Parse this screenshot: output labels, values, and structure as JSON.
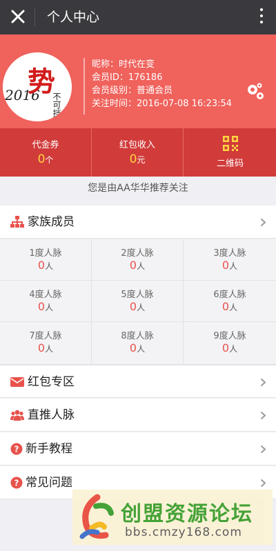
{
  "header": {
    "title": "个人中心"
  },
  "profile": {
    "avatar_text_year": "2016",
    "avatar_text_main": "势",
    "avatar_text_side": "不可挡",
    "nickname": "昵称：时代在变",
    "member_id": "会员ID：176186",
    "member_level": "会员级别：普通会员",
    "follow_time": "关注时间：2016-07-08 16:23:54"
  },
  "stats": [
    {
      "label": "代金券",
      "value": "0",
      "unit": "个"
    },
    {
      "label": "红包收入",
      "value": "0",
      "unit": "元"
    },
    {
      "label": "二维码"
    }
  ],
  "recommend_text": "您是由AA华华推荐关注",
  "family": {
    "label": "家族成员"
  },
  "network": [
    {
      "label": "1度人脉",
      "value": "0",
      "unit": "人"
    },
    {
      "label": "2度人脉",
      "value": "0",
      "unit": "人"
    },
    {
      "label": "3度人脉",
      "value": "0",
      "unit": "人"
    },
    {
      "label": "4度人脉",
      "value": "0",
      "unit": "人"
    },
    {
      "label": "5度人脉",
      "value": "0",
      "unit": "人"
    },
    {
      "label": "6度人脉",
      "value": "0",
      "unit": "人"
    },
    {
      "label": "7度人脉",
      "value": "0",
      "unit": "人"
    },
    {
      "label": "8度人脉",
      "value": "0",
      "unit": "人"
    },
    {
      "label": "9度人脉",
      "value": "0",
      "unit": "人"
    }
  ],
  "menu": [
    {
      "label": "红包专区",
      "icon": "envelope-icon"
    },
    {
      "label": "直推人脉",
      "icon": "users-icon"
    },
    {
      "label": "新手教程",
      "icon": "question-icon"
    },
    {
      "label": "常见问题",
      "icon": "question-icon"
    }
  ],
  "watermark": {
    "title": "创盟资源论坛",
    "url": "bbs.cmzy168.com"
  },
  "colors": {
    "brand_red": "#f0625c",
    "stats_red": "#d13b3a",
    "accent_yellow": "#ffd440",
    "icon_red": "#e8524c"
  }
}
